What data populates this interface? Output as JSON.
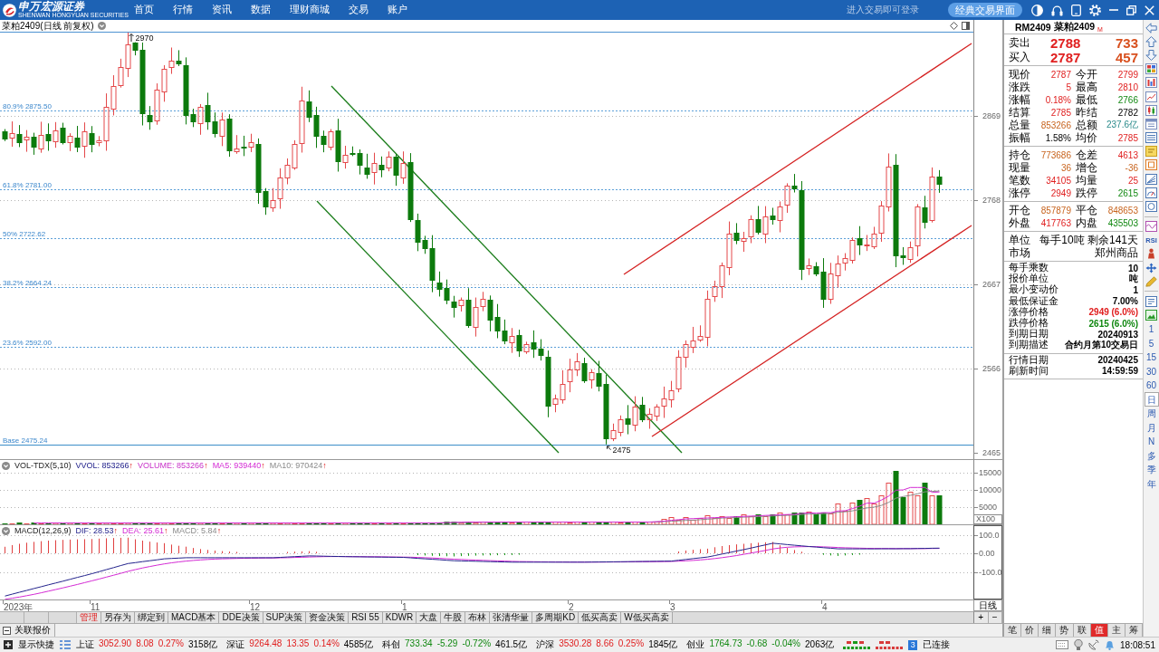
{
  "app_bar": {
    "logo": {
      "name": "申万宏源证券",
      "subtitle": "SHENWAN HONGYUAN SECURITIES"
    },
    "nav": [
      "首页",
      "行情",
      "资讯",
      "数据",
      "理财商城",
      "交易",
      "账户"
    ],
    "login_hint": "进入交易即可登录",
    "mode_button": "经典交易界面"
  },
  "chart": {
    "title": "菜粕2409(日线 前复权)",
    "price_axis": [
      "2869",
      "2768",
      "2667",
      "2566",
      "2465"
    ],
    "fib_levels": [
      "80.9% 2875.50",
      "61.8% 2781.00",
      "50% 2722.62",
      "38.2% 2664.24",
      "23.6% 2592.00",
      "Base 2475.24"
    ],
    "high_marker": "2970",
    "low_marker": "2475"
  },
  "volume_panel": {
    "legend": [
      {
        "text": "VOL-TDX(5,10)",
        "kind": "name"
      },
      {
        "text": "VVOL: 853266",
        "arrow": "↑",
        "kind": "vvol"
      },
      {
        "text": "VOLUME: 853266",
        "arrow": "↑",
        "kind": "volume"
      },
      {
        "text": "MA5: 939440",
        "arrow": "↑",
        "kind": "ma5"
      },
      {
        "text": "MA10: 970424",
        "arrow": "↑",
        "kind": "ma10"
      }
    ],
    "axis": [
      "15000",
      "10000",
      "5000"
    ],
    "unit": "X100"
  },
  "macd_panel": {
    "legend": [
      {
        "text": "MACD(12,26,9)",
        "kind": "name"
      },
      {
        "text": "DIF: 28.53",
        "arrow": "↑",
        "kind": "dif"
      },
      {
        "text": "DEA: 25.61",
        "arrow": "↑",
        "kind": "dea"
      },
      {
        "text": "MACD: 5.84",
        "arrow": "↑",
        "kind": "macd"
      }
    ],
    "axis": [
      "100.0",
      "0.00",
      "-100.0"
    ]
  },
  "date_axis": {
    "labels": [
      "2023年",
      "11",
      "12",
      "1",
      "2",
      "3",
      "4"
    ],
    "period": "日线"
  },
  "formula_tabs": [
    {
      "label": "管理",
      "kind": "manage"
    },
    {
      "label": "另存为",
      "kind": "formula"
    },
    {
      "label": "绑定到",
      "kind": "formula"
    },
    {
      "label": "MACD基本",
      "kind": "formula"
    },
    {
      "label": "DDE决策",
      "kind": "formula"
    },
    {
      "label": "SUP决策",
      "kind": "formula"
    },
    {
      "label": "资金决策",
      "kind": "formula"
    },
    {
      "label": "RSI 55",
      "kind": "formula"
    },
    {
      "label": "KDWR",
      "kind": "formula"
    },
    {
      "label": "大盘",
      "kind": "formula"
    },
    {
      "label": "牛股",
      "kind": "formula"
    },
    {
      "label": "布林",
      "kind": "formula"
    },
    {
      "label": "张清华量",
      "kind": "formula"
    },
    {
      "label": "多周期KD",
      "kind": "formula"
    },
    {
      "label": "低买高卖",
      "kind": "formula"
    },
    {
      "label": "W低买高卖",
      "kind": "formula"
    }
  ],
  "zoom_buttons": [
    "+",
    "−"
  ],
  "linked_quotes": "关联报价",
  "quote_panel": {
    "code": "RM2409",
    "name": "菜粕2409",
    "badge": "M",
    "book": [
      {
        "label": "卖出",
        "price": "2788",
        "volume": "733"
      },
      {
        "label": "买入",
        "price": "2787",
        "volume": "457"
      }
    ],
    "sections": [
      {
        "kind": "grid",
        "rows": [
          [
            {
              "label": "现价",
              "value": "2787",
              "kind": "up"
            },
            {
              "label": "今开",
              "value": "2799",
              "kind": "up"
            }
          ],
          [
            {
              "label": "涨跌",
              "value": "5",
              "kind": "up"
            },
            {
              "label": "最高",
              "value": "2810",
              "kind": "up"
            }
          ],
          [
            {
              "label": "涨幅",
              "value": "0.18%",
              "kind": "up"
            },
            {
              "label": "最低",
              "value": "2766",
              "kind": "down"
            }
          ],
          [
            {
              "label": "结算",
              "value": "2785",
              "kind": "up"
            },
            {
              "label": "昨结",
              "value": "2782",
              "kind": "flat"
            }
          ],
          [
            {
              "label": "总量",
              "value": "853266",
              "kind": "volume"
            },
            {
              "label": "总额",
              "value": "237.6亿",
              "kind": "amount"
            }
          ],
          [
            {
              "label": "振幅",
              "value": "1.58%",
              "kind": "flat"
            },
            {
              "label": "均价",
              "value": "2785",
              "kind": "up"
            }
          ]
        ]
      },
      {
        "kind": "grid",
        "rows": [
          [
            {
              "label": "持仓",
              "value": "773686",
              "kind": "volume"
            },
            {
              "label": "仓差",
              "value": "4613",
              "kind": "up"
            }
          ],
          [
            {
              "label": "现量",
              "value": "36",
              "kind": "volume"
            },
            {
              "label": "增仓",
              "value": "-36",
              "kind": "volume"
            }
          ],
          [
            {
              "label": "笔数",
              "value": "34105",
              "kind": "up"
            },
            {
              "label": "均量",
              "value": "25",
              "kind": "up"
            }
          ],
          [
            {
              "label": "涨停",
              "value": "2949",
              "kind": "up"
            },
            {
              "label": "跌停",
              "value": "2615",
              "kind": "down"
            }
          ]
        ]
      },
      {
        "kind": "grid",
        "rows": [
          [
            {
              "label": "开仓",
              "value": "857879",
              "kind": "volume"
            },
            {
              "label": "平仓",
              "value": "848653",
              "kind": "volume"
            }
          ],
          [
            {
              "label": "外盘",
              "value": "417763",
              "kind": "up"
            },
            {
              "label": "内盘",
              "value": "435503",
              "kind": "down"
            }
          ]
        ]
      },
      {
        "kind": "summary",
        "rows": [
          {
            "label": "单位",
            "value": "每手10吨 剩余141天"
          },
          {
            "label": "市场",
            "value": "郑州商品"
          }
        ]
      },
      {
        "kind": "list",
        "rows": [
          {
            "label": "每手乘数",
            "value": "10",
            "kind": "flat"
          },
          {
            "label": "报价单位",
            "value": "吨",
            "kind": "flat"
          },
          {
            "label": "最小变动价",
            "value": "1",
            "kind": "flat"
          },
          {
            "label": "最低保证金",
            "value": "7.00%",
            "kind": "flat"
          },
          {
            "label": "涨停价格",
            "value": "2949 (6.0%)",
            "kind": "up"
          },
          {
            "label": "跌停价格",
            "value": "2615 (6.0%)",
            "kind": "down"
          },
          {
            "label": "到期日期",
            "value": "20240913",
            "kind": "flat"
          },
          {
            "label": "到期描述",
            "value": "合约月第10交易日",
            "kind": "flat"
          }
        ]
      },
      {
        "kind": "list",
        "rows": [
          {
            "label": "行情日期",
            "value": "20240425",
            "kind": "flat"
          },
          {
            "label": "刷新时间",
            "value": "14:59:59",
            "kind": "flat"
          }
        ]
      }
    ]
  },
  "side_toolbar": {
    "text_tool": "RSI",
    "periods": [
      {
        "label": "1",
        "selected": false
      },
      {
        "label": "5",
        "selected": false
      },
      {
        "label": "15",
        "selected": false
      },
      {
        "label": "30",
        "selected": false
      },
      {
        "label": "60",
        "selected": false
      },
      {
        "label": "日",
        "selected": true
      },
      {
        "label": "周",
        "selected": false
      },
      {
        "label": "月",
        "selected": false
      },
      {
        "label": "N",
        "selected": false
      },
      {
        "label": "多",
        "selected": false
      },
      {
        "label": "季",
        "selected": false
      },
      {
        "label": "年",
        "selected": false
      }
    ]
  },
  "panel_tabs": [
    {
      "label": "笔",
      "selected": false
    },
    {
      "label": "价",
      "selected": false
    },
    {
      "label": "细",
      "selected": false
    },
    {
      "label": "势",
      "selected": false
    },
    {
      "label": "联",
      "selected": false
    },
    {
      "label": "值",
      "selected": true
    },
    {
      "label": "主",
      "selected": false
    },
    {
      "label": "筹",
      "selected": false
    }
  ],
  "status_bar": {
    "shortcut": "显示快捷",
    "markets": [
      {
        "name": "上证",
        "price": "3052.90",
        "change": "8.08",
        "percent": "0.27%",
        "amount": "3158亿",
        "kind": "up"
      },
      {
        "name": "深证",
        "price": "9264.48",
        "change": "13.35",
        "percent": "0.14%",
        "amount": "4585亿",
        "kind": "up"
      },
      {
        "name": "科创",
        "price": "733.34",
        "change": "-5.29",
        "percent": "-0.72%",
        "amount": "461.5亿",
        "kind": "down"
      },
      {
        "name": "沪深",
        "price": "3530.28",
        "change": "8.66",
        "percent": "0.25%",
        "amount": "1845亿",
        "kind": "up"
      },
      {
        "name": "创业",
        "price": "1764.73",
        "change": "-0.68",
        "percent": "-0.04%",
        "amount": "2063亿",
        "kind": "down"
      }
    ],
    "connection_count": "3",
    "connection": "已连接",
    "time": "18:08:51"
  }
}
